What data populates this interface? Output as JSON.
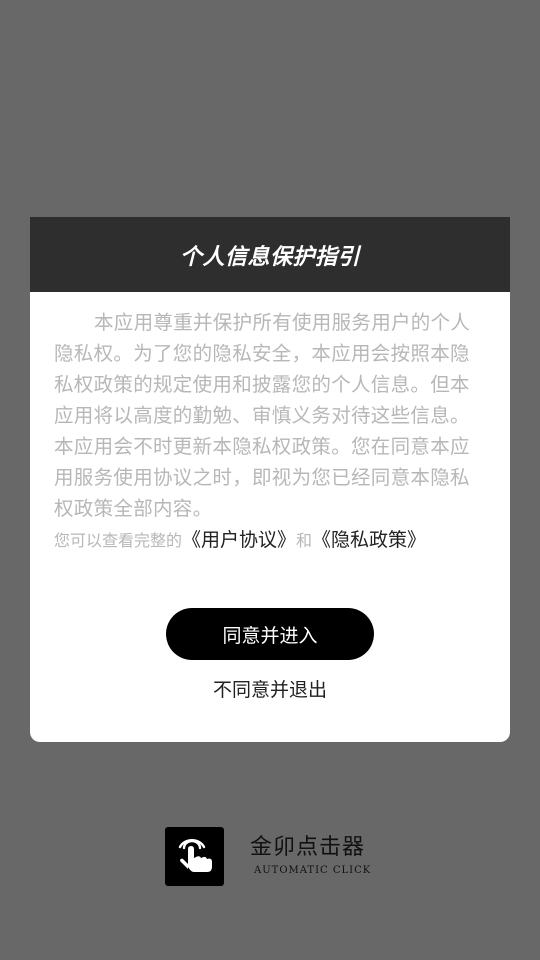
{
  "dialog": {
    "title": "个人信息保护指引",
    "body_text": "本应用尊重并保护所有使用服务用户的个人隐私权。为了您的隐私安全，本应用会按照本隐私权政策的规定使用和披露您的个人信息。但本应用将以高度的勤勉、审慎义务对待这些信息。本应用会不时更新本隐私权政策。您在同意本应用服务使用协议之时，即视为您已经同意本隐私权政策全部内容。",
    "links_prefix": "您可以查看完整的",
    "user_agreement_link": "《用户协议》",
    "links_and": "和",
    "privacy_policy_link": "《隐私政策》",
    "agree_button": "同意并进入",
    "decline_button": "不同意并退出"
  },
  "brand": {
    "app_name": "金卯点击器",
    "subtitle": "AUTOMATIC CLICK",
    "logo_icon": "tap-hand-icon"
  },
  "colors": {
    "overlay_background": "#686868",
    "dialog_header": "#2e2e2e",
    "dialog_background": "#ffffff",
    "body_text": "#b7b7b7",
    "primary_button": "#000000"
  }
}
